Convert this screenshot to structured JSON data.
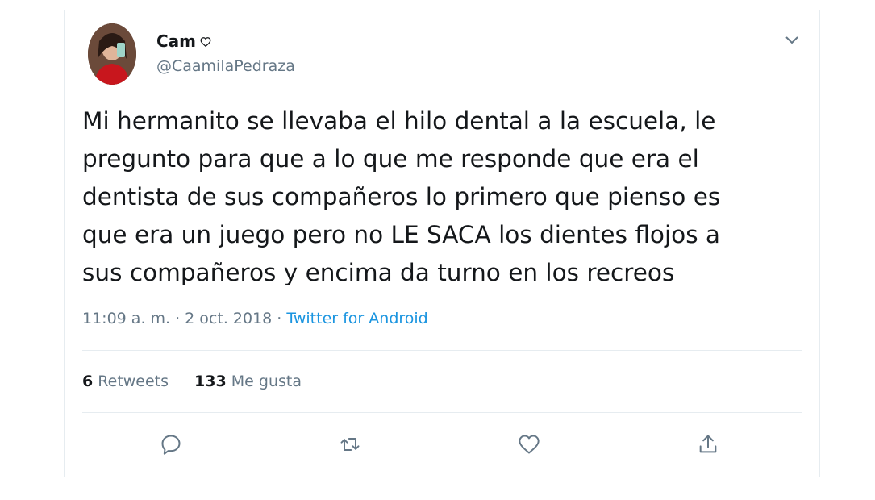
{
  "tweet": {
    "author_name": "Cam",
    "author_handle": "@CaamilaPedraza",
    "text": "Mi hermanito se llevaba el hilo dental a la escuela, le\npregunto para que a lo que me responde que era el\ndentista de sus compañeros lo primero que pienso es\nque era un juego pero no LE SACA los dientes flojos a\nsus compañeros y encima da turno en los recreos",
    "time": "11:09 a. m. · 2 oct. 2018 · ",
    "source": "Twitter for Android",
    "retweets_count": "6",
    "retweets_label": "Retweets",
    "likes_count": "133",
    "likes_label": "Me gusta"
  },
  "colors": {
    "accent": "#1b95e0",
    "secondary_text": "#657786",
    "primary_text": "#14171a",
    "divider": "#e6ecf0"
  },
  "icons": [
    "heart-icon",
    "chevron-down-icon",
    "reply-icon",
    "retweet-icon",
    "like-icon",
    "share-icon"
  ]
}
